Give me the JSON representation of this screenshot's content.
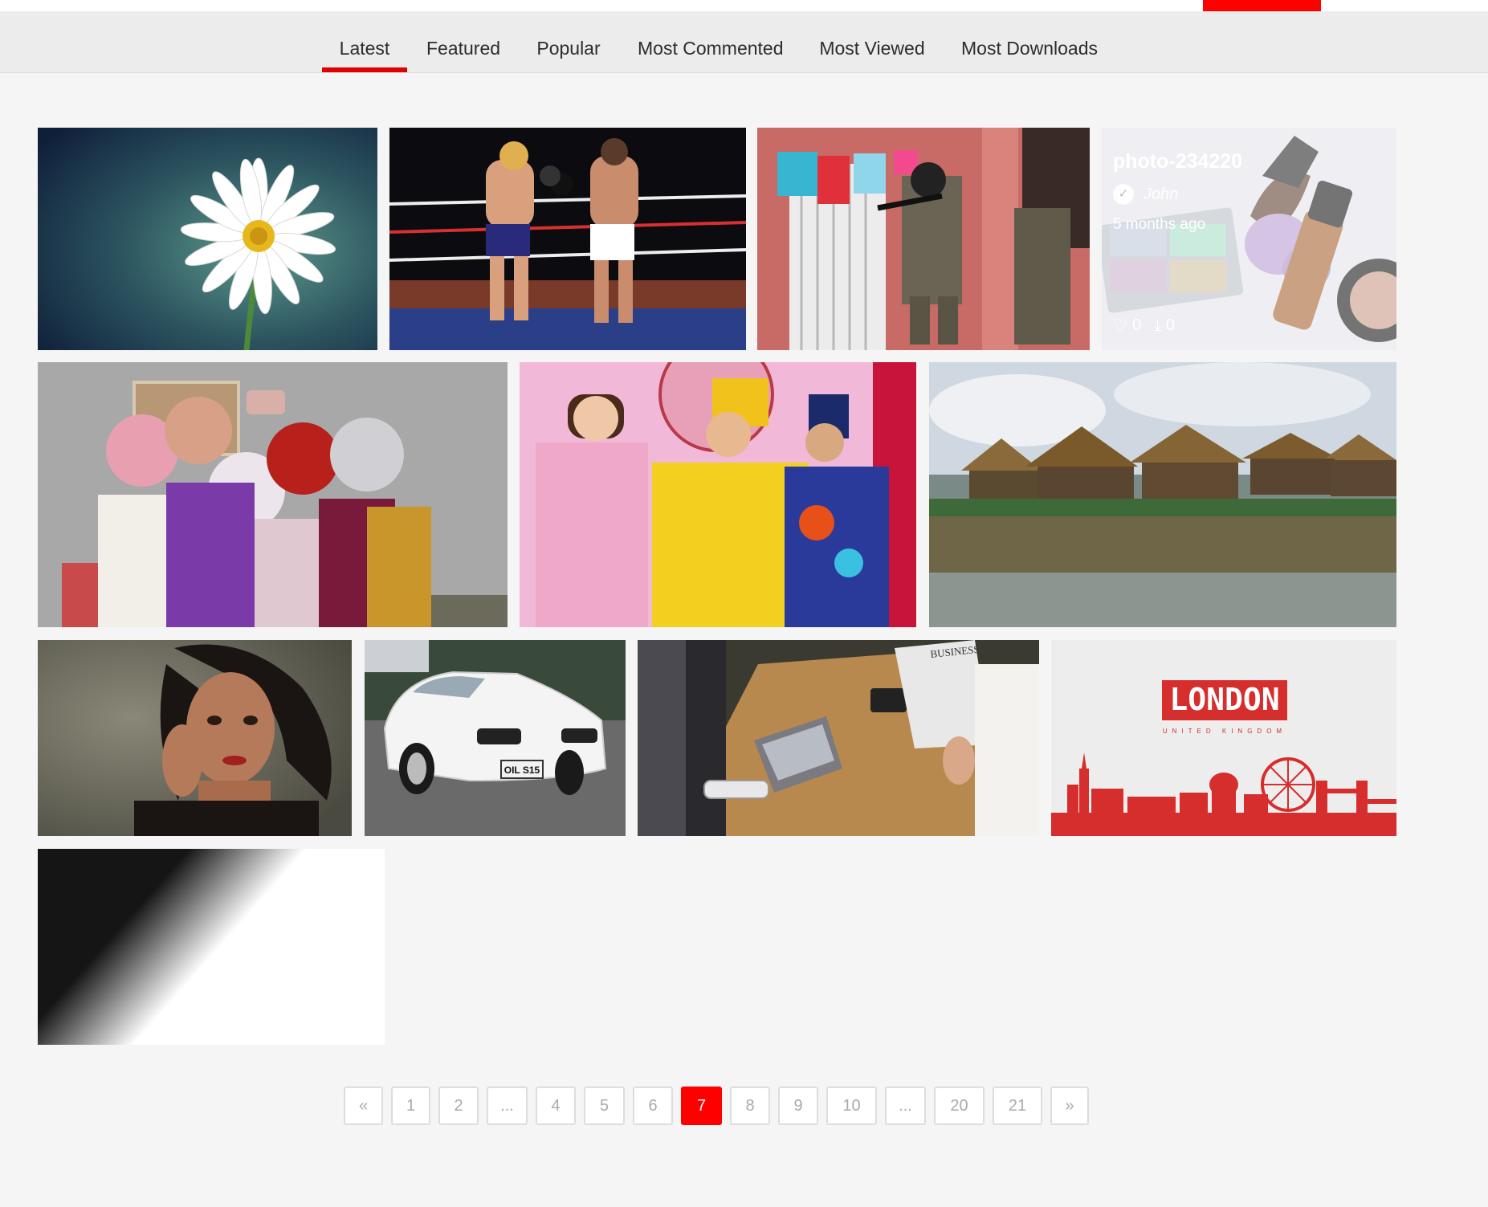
{
  "colors": {
    "accent": "#ff0000",
    "tab_underline": "#e00000",
    "background": "#f5f5f5",
    "tabbar": "#ececec"
  },
  "tabs": [
    {
      "label": "Latest",
      "active": true
    },
    {
      "label": "Featured",
      "active": false
    },
    {
      "label": "Popular",
      "active": false
    },
    {
      "label": "Most Commented",
      "active": false
    },
    {
      "label": "Most Viewed",
      "active": false
    },
    {
      "label": "Most Downloads",
      "active": false
    }
  ],
  "gallery": {
    "photos": [
      {
        "subject": "daisy-flower"
      },
      {
        "subject": "boxing-match"
      },
      {
        "subject": "soldiers-raid"
      },
      {
        "subject": "makeup-products",
        "hover": {
          "title": "photo-234220",
          "user": "John",
          "time": "5 months ago",
          "likes": "0",
          "downloads": "0"
        }
      },
      {
        "subject": "cosplay-selfie"
      },
      {
        "subject": "costume-stage-show"
      },
      {
        "subject": "stilt-village"
      },
      {
        "subject": "portrait-woman"
      },
      {
        "subject": "white-sports-car",
        "plate": "OIL S15"
      },
      {
        "subject": "business-meeting",
        "newspaper": "BUSINESS"
      },
      {
        "subject": "london-skyline",
        "title": "LONDON",
        "subtitle": "UNITED KINGDOM"
      },
      {
        "subject": "gradient"
      }
    ]
  },
  "pagination": {
    "prev": "«",
    "next": "»",
    "pages": [
      "1",
      "2",
      "...",
      "4",
      "5",
      "6",
      "7",
      "8",
      "9",
      "10",
      "...",
      "20",
      "21"
    ],
    "current": "7"
  }
}
